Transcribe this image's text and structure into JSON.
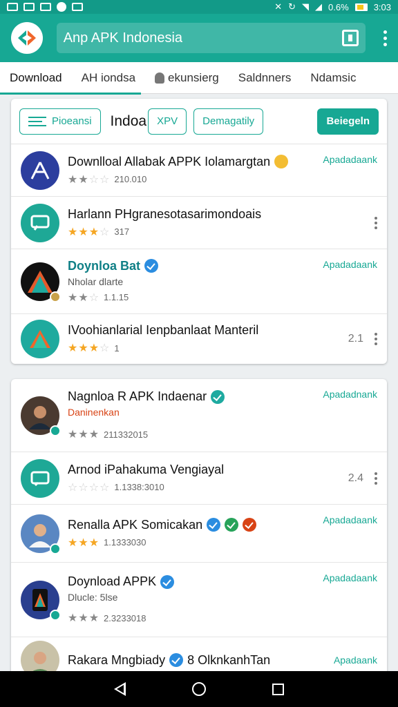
{
  "status": {
    "battery_text": "0.6%",
    "time": "3:03"
  },
  "appbar": {
    "title": "Anp APK Indonesia"
  },
  "tabs": [
    "Download",
    "AH iondsa",
    "ekunsierg",
    "Saldnners",
    "Ndamsic"
  ],
  "filters": {
    "chip1": "Pioeansi",
    "title": "Indoa",
    "chip2": "XPV",
    "chip3": "Demagatily",
    "primary": "Beiegeln"
  },
  "card1": [
    {
      "name": "Downlloal Allabak APPK Iolamargtan",
      "rating_text": "210.010",
      "action": "Apadadaank",
      "stars": 2,
      "avatar_color": "#2c3e9e",
      "icon": "app-icon"
    },
    {
      "name": "Harlann PHgranesotasarimondoais",
      "rating_text": "317",
      "stars": 3,
      "avatar_color": "#1ea896",
      "icon": "message-icon"
    },
    {
      "name": "Doynloa Bat",
      "sub": "Nholar dlarte",
      "rating_text": "1.1.15",
      "action": "Apadadaank",
      "stars": 2,
      "avatar_color": "#111111",
      "icon": "triangle-icon"
    },
    {
      "name": "IVoohianlarial Ienpbanlaat Manteril",
      "rating_text": "1",
      "num": "2.1",
      "stars": 3,
      "avatar_color": "#1eaa9e",
      "icon": "triangle-icon"
    }
  ],
  "card2": [
    {
      "name": "Nagnloa R APK Indaenar",
      "sub": "Daninenkan",
      "rating_text": "211332015",
      "action": "Apadadnank",
      "stars": 3,
      "avatar_color": "#4a3a30",
      "icon": "person-icon"
    },
    {
      "name": "Arnod iPahakuma Vengiayal",
      "rating_text": "1.1338:3010",
      "num": "2.4",
      "stars": 0,
      "avatar_color": "#1ea896",
      "icon": "chat-icon"
    },
    {
      "name": "Renalla APK Somicakan",
      "rating_text": "1.1333030",
      "action": "Apadadaank",
      "stars": 3,
      "avatar_color": "#5a87c2",
      "icon": "person-icon"
    },
    {
      "name": "Doynload APPK",
      "sub": "Dlucle: 5lse",
      "rating_text": "2.3233018",
      "action": "Apadadaank",
      "stars": 3,
      "avatar_color": "#2a3f8f",
      "icon": "phone-icon"
    },
    {
      "name": "Rakara Mngbiady",
      "name_suffix": "8 OlknkanhTan",
      "action": "Apadaank",
      "avatar_color": "#c9c2a8",
      "icon": "person-icon"
    }
  ],
  "colors": {
    "accent": "#17a894",
    "statusbar": "#129a88"
  }
}
